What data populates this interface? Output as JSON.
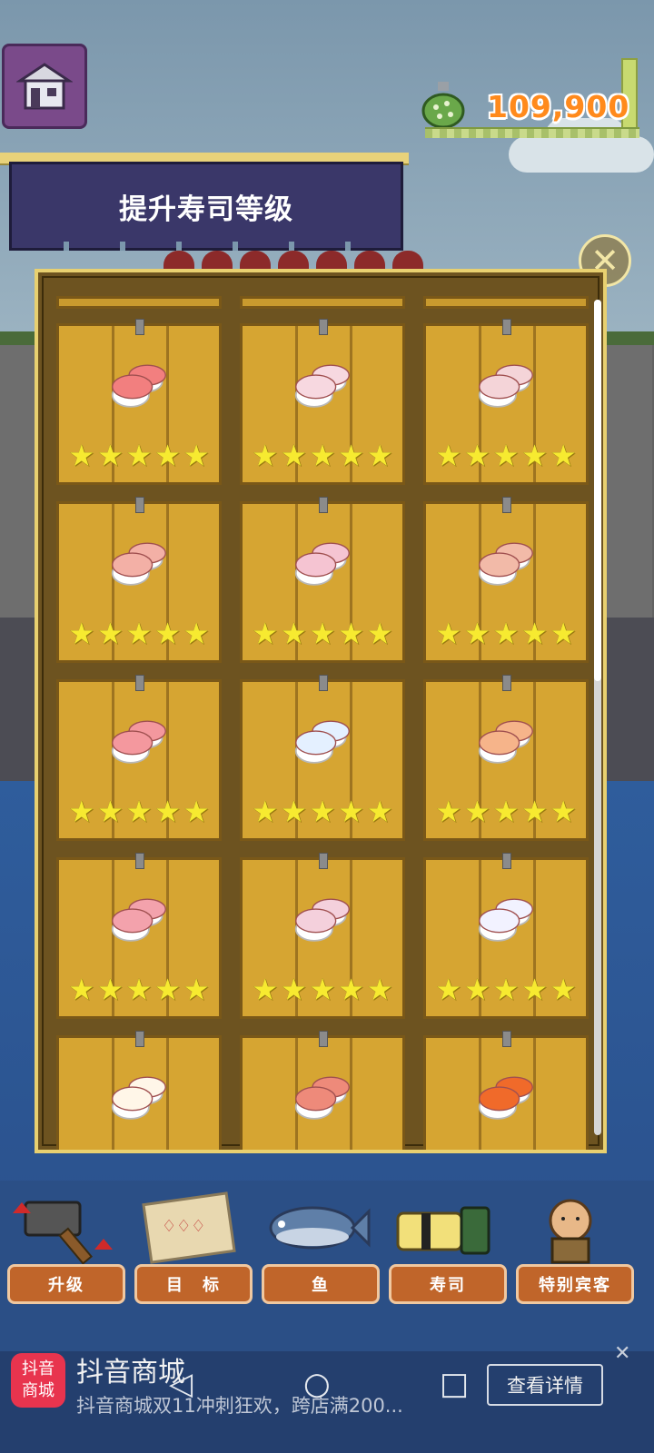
{
  "currency": {
    "amount": "109,900",
    "icon": "money-bag-icon"
  },
  "banner": {
    "title": "提升寿司等级"
  },
  "sushi_grid": [
    {
      "name": "tuna-nigiri",
      "color": "#f27f7f",
      "stars": 5
    },
    {
      "name": "squid-nigiri",
      "color": "#f7d8e0",
      "stars": 5
    },
    {
      "name": "sea-bream-nigiri",
      "color": "#f4d4d8",
      "stars": 5
    },
    {
      "name": "shrimp-nigiri-a",
      "color": "#f3b0a6",
      "stars": 5
    },
    {
      "name": "shrimp-nigiri-b",
      "color": "#f5c4d2",
      "stars": 5
    },
    {
      "name": "shrimp-nigiri-c",
      "color": "#f2baa8",
      "stars": 5
    },
    {
      "name": "fatty-tuna-nigiri",
      "color": "#f4989e",
      "stars": 5
    },
    {
      "name": "white-fish-nigiri",
      "color": "#e4f0ff",
      "stars": 5
    },
    {
      "name": "salmon-nigiri",
      "color": "#f6b48a",
      "stars": 5
    },
    {
      "name": "crab-nigiri",
      "color": "#f3a2ac",
      "stars": 5
    },
    {
      "name": "flounder-nigiri",
      "color": "#f4d0dc",
      "stars": 5
    },
    {
      "name": "halibut-nigiri",
      "color": "#f2f2ff",
      "stars": 5
    },
    {
      "name": "scallop-nigiri",
      "color": "#fff6e8",
      "stars": 0
    },
    {
      "name": "sweet-shrimp-nigiri",
      "color": "#ee8a7a",
      "stars": 0
    },
    {
      "name": "salmon-roe-gunkan",
      "color": "#f06a2a",
      "stars": 0
    }
  ],
  "bottom_nav": [
    {
      "label": "升级",
      "icon": "hammer-icon"
    },
    {
      "label": "目　标",
      "icon": "goal-board-icon"
    },
    {
      "label": "鱼",
      "icon": "fish-icon"
    },
    {
      "label": "寿司",
      "icon": "sushi-icon"
    },
    {
      "label": "特别宾客",
      "icon": "guest-icon"
    }
  ],
  "ad": {
    "logo": "抖音\n商城",
    "title": "抖音商城",
    "subtitle": "抖音商城双11冲刺狂欢，跨店满200...",
    "button": "查看详情"
  },
  "colors": {
    "accent": "#ff8a1c",
    "banner": "#3a3769",
    "card": "#d6a532",
    "star": "#f7ea30",
    "nav": "#c0652a"
  }
}
